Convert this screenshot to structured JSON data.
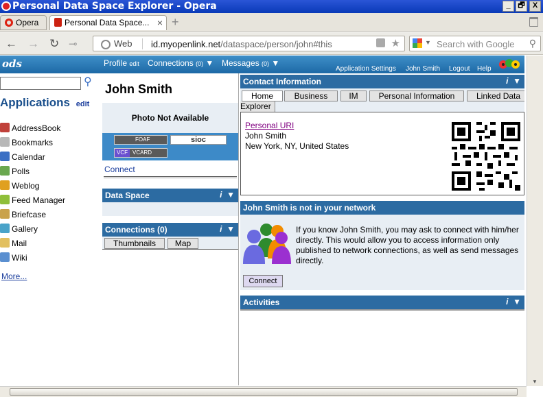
{
  "window": {
    "title": "Personal Data Space Explorer - Opera",
    "minimize": "_",
    "maximize": "🗗",
    "close": "X"
  },
  "tabs": {
    "menu_label": "Opera",
    "active_tab": "Personal Data Space...",
    "close_symbol": "×",
    "new_tab_symbol": "+"
  },
  "address_bar": {
    "mode_label": "Web",
    "url_host": "id.myopenlink.net",
    "url_path": "/dataspace/person/john#this",
    "search_placeholder": "Search with Google"
  },
  "ods_header": {
    "logo": "ods",
    "profile": "Profile",
    "profile_edit": "edit",
    "connections": "Connections",
    "connections_count": "(0)",
    "messages": "Messages",
    "messages_count": "(0)",
    "links": [
      "Application Settings",
      "John Smith",
      "Logout",
      "Help"
    ]
  },
  "sidebar": {
    "heading": "Applications",
    "edit": "edit",
    "items": [
      {
        "label": "AddressBook",
        "color": "#c0413a"
      },
      {
        "label": "Bookmarks",
        "color": "#b8b8b8"
      },
      {
        "label": "Calendar",
        "color": "#3a6fc4"
      },
      {
        "label": "Polls",
        "color": "#6aa84f"
      },
      {
        "label": "Weblog",
        "color": "#e0a020"
      },
      {
        "label": "Feed Manager",
        "color": "#8fbf3a"
      },
      {
        "label": "Briefcase",
        "color": "#c9a24a"
      },
      {
        "label": "Gallery",
        "color": "#4aa3c9"
      },
      {
        "label": "Mail",
        "color": "#e2c060"
      },
      {
        "label": "Wiki",
        "color": "#5a8fd0"
      }
    ],
    "more": "More..."
  },
  "profile": {
    "name": "John Smith",
    "photo_text": "Photo Not Available",
    "foaf_badge": "FOAF",
    "sioc_badge": "sioc",
    "vcard_badge": "VCARD",
    "vcf": "VCF",
    "connect": "Connect"
  },
  "data_space": {
    "heading": "Data Space"
  },
  "connections_panel": {
    "heading": "Connections (0)",
    "tabs": [
      "Thumbnails",
      "Map"
    ]
  },
  "contact_info": {
    "heading": "Contact Information",
    "tabs": [
      "Home",
      "Business",
      "IM",
      "Personal Information",
      "Linked Data",
      "Explorer"
    ],
    "uri_label": "Personal URI",
    "name": "John Smith",
    "location": "New York, NY, United States"
  },
  "network": {
    "heading": "John Smith is not in your network",
    "message": "If you know John Smith, you may ask to connect with him/her directly. This would allow you to access information only published to network connections, as well as send messages directly.",
    "connect_button": "Connect"
  },
  "activities": {
    "heading": "Activities"
  },
  "panel_controls": {
    "info": "i",
    "toggle": "▼"
  },
  "colors": {
    "panel_header": "#2c6ba2",
    "ods_bar": "#2a7bbd",
    "link": "#1a3d9c"
  }
}
